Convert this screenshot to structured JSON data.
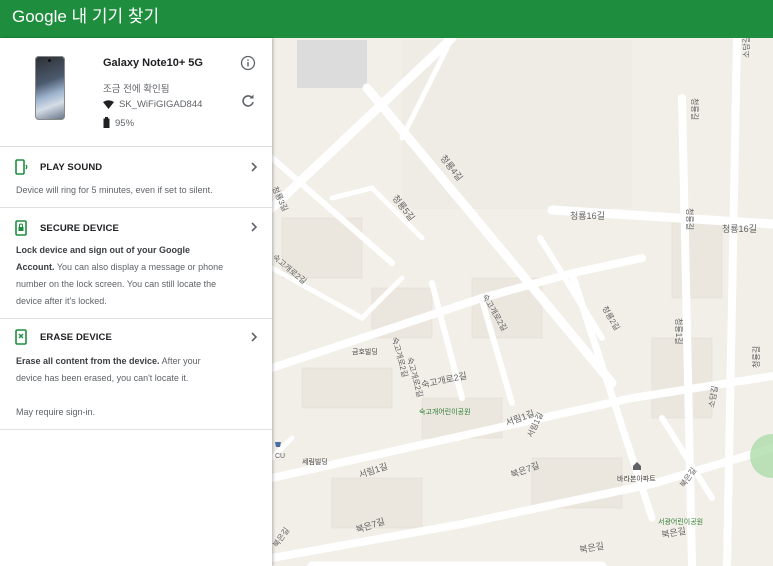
{
  "header": {
    "title": "Google 내 기기 찾기"
  },
  "device": {
    "name": "Galaxy Note10+ 5G",
    "status": "조금 전에 확인됨",
    "wifi": "SK_WiFiGIGAD844",
    "battery": "95%",
    "icons": [
      "phone-image",
      "info-icon",
      "refresh-icon",
      "wifi-icon",
      "battery-icon"
    ]
  },
  "actions": {
    "play_sound": {
      "title": "PLAY SOUND",
      "description": "Device will ring for 5 minutes, even if set to silent.",
      "icon": "phone-ring-icon"
    },
    "secure_device": {
      "title": "SECURE DEVICE",
      "description_bold": "Lock device and sign out of your Google Account.",
      "description": "You can also display a message or phone number on the lock screen. You can still locate the device after it's locked.",
      "icon": "phone-lock-icon"
    },
    "erase_device": {
      "title": "ERASE DEVICE",
      "description_bold": "Erase all content from the device.",
      "description": "After your device has been erased, you can't locate it.",
      "note": "May require sign-in.",
      "icon": "phone-erase-icon"
    }
  },
  "map": {
    "labels": {
      "l1": "청룡16길",
      "l2": "청룡16길",
      "l3": "청룡4길",
      "l4": "청룡5길",
      "l5": "숙고개로2길",
      "l6": "숙고개로2길",
      "l7": "숙고개로2길",
      "l8": "숙고개로2길",
      "l9": "청룡2길",
      "l10": "청룡3길",
      "l11": "서림1길",
      "l12": "서림1길",
      "l13": "서림1길",
      "l14": "북은7길",
      "l15": "북은7길",
      "l16": "북은길",
      "l17": "북은길",
      "l18": "북은길",
      "l19": "북은길",
      "l20": "숙고개로2길",
      "l21": "청룡길",
      "l22": "청룡길",
      "l23": "청룡1길",
      "l24": "소담길",
      "l25": "소담길",
      "l26": "청룡길",
      "poi1": "금호빌딩",
      "poi2": "숙고개어린이공원",
      "poi3": "세림빌딩",
      "poi4": "바라본아파트",
      "poi5": "서광어린이공원",
      "cu": "CU"
    },
    "colors": {
      "park": "#c8e6c9",
      "land": "#f2efe9",
      "road": "#ffffff"
    }
  },
  "colors": {
    "accent": "#1e8e3e",
    "green_icon": "#1e8e3e"
  }
}
